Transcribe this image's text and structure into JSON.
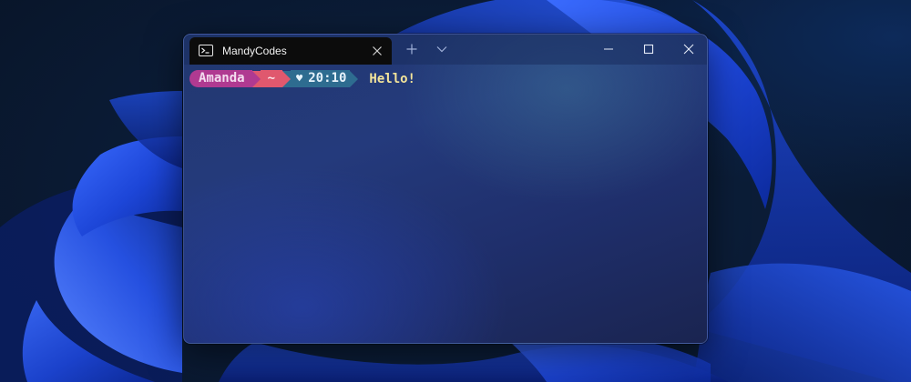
{
  "colors": {
    "user_segment": "#b03a91",
    "path_segment": "#e0586e",
    "time_segment": "#2e6c90",
    "greeting_text": "#f3e49a",
    "tab_background": "#0c0c0c"
  },
  "window": {
    "tab": {
      "icon": "powershell-icon",
      "title": "MandyCodes",
      "close_icon": "close-icon"
    },
    "new_tab_icon": "plus-icon",
    "dropdown_icon": "chevron-down-icon",
    "controls": {
      "minimize_icon": "minimize-icon",
      "maximize_icon": "maximize-icon",
      "close_icon": "close-icon"
    }
  },
  "terminal": {
    "prompt": {
      "user": "Amanda",
      "path": "~",
      "heart": "♥",
      "time": "20:10"
    },
    "output": "Hello!"
  }
}
